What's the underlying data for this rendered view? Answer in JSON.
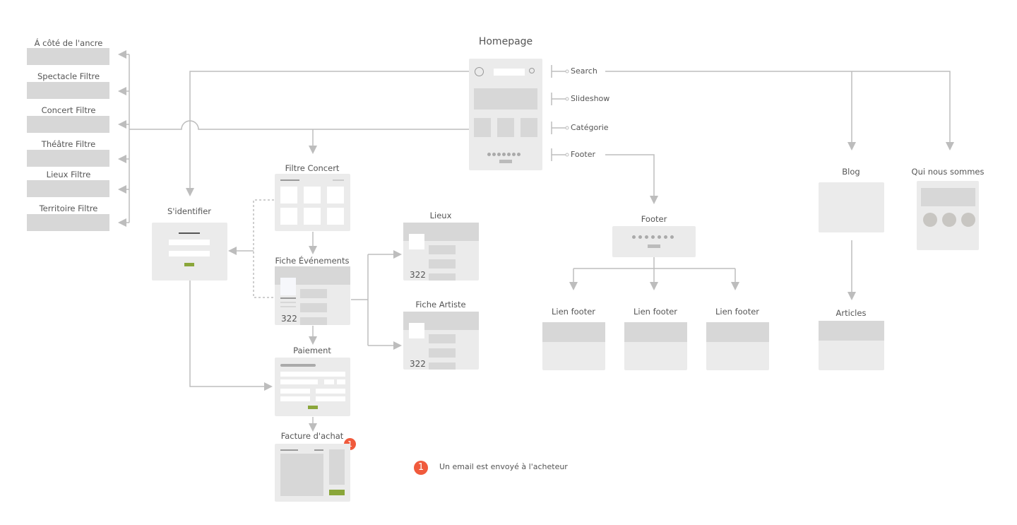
{
  "title": "Homepage",
  "left_filters": [
    "Á côté de l'ancre",
    "Spectacle Filtre",
    "Concert Filtre",
    "Théâtre Filtre",
    "Lieux Filtre",
    "Territoire Filtre"
  ],
  "homepage_sections": [
    "Search",
    "Slideshow",
    "Catégorie",
    "Footer"
  ],
  "pages": {
    "identifier": "S'identifier",
    "filtre_concert": "Filtre Concert",
    "fiche_evenements": "Fiche Événements",
    "paiement": "Paiement",
    "facture": "Facture d'achat",
    "lieux": "Lieux",
    "fiche_artiste": "Fiche Artiste",
    "footer": "Footer",
    "lien_footer": [
      "Lien footer",
      "Lien footer",
      "Lien footer"
    ],
    "blog": "Blog",
    "qui": "Qui nous sommes",
    "articles": "Articles"
  },
  "counts": {
    "evenements": "322",
    "lieux": "322",
    "artiste": "322"
  },
  "note": {
    "badge": "1",
    "text": "Un email est envoyé à l'acheteur"
  },
  "colors": {
    "accent": "#8aa63a",
    "badge": "#f05a3c",
    "line": "#bdbdbd"
  }
}
